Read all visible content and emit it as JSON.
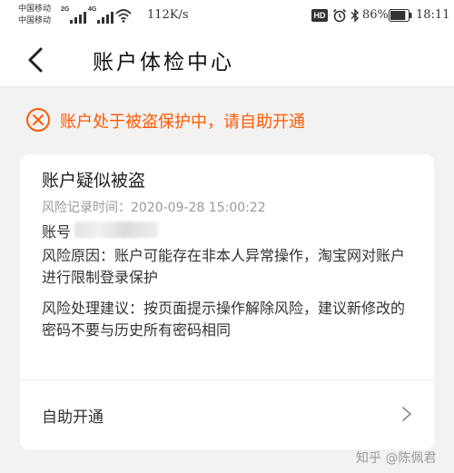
{
  "status_bar": {
    "carrier_1": "中国移动",
    "carrier_2": "中国移动",
    "signal_1_tag": "2G",
    "signal_2_tag": "4G",
    "net_speed": "112K/s",
    "hd_badge": "HD",
    "battery_percent": "86%",
    "battery_level": 0.86,
    "time": "18:11",
    "icons": [
      "signal-icon",
      "wifi-icon",
      "alarm-icon",
      "bluetooth-icon",
      "battery-icon"
    ]
  },
  "header": {
    "back_icon": "chevron-left-icon",
    "title": "账户体检中心"
  },
  "alert": {
    "icon": "close-circle-icon",
    "text": "账户处于被盗保护中，请自助开通"
  },
  "card": {
    "title": "账户疑似被盗",
    "record_time_label": "风险记录时间：",
    "record_time_value": "2020-09-28 15:00:22",
    "account_label": "账号",
    "reason": "风险原因：账户可能存在非本人异常操作，淘宝网对账户进行限制登录保护",
    "advice": "风险处理建议：按页面提示操作解除风险，建议新修改的密码不要与历史所有密码相同",
    "action_label": "自助开通",
    "action_icon": "chevron-right-icon"
  },
  "watermark": "知乎 @陈佩君",
  "colors": {
    "accent": "#ff5a00",
    "background": "#f2f2f2",
    "card": "#ffffff",
    "muted_text": "#999999"
  }
}
